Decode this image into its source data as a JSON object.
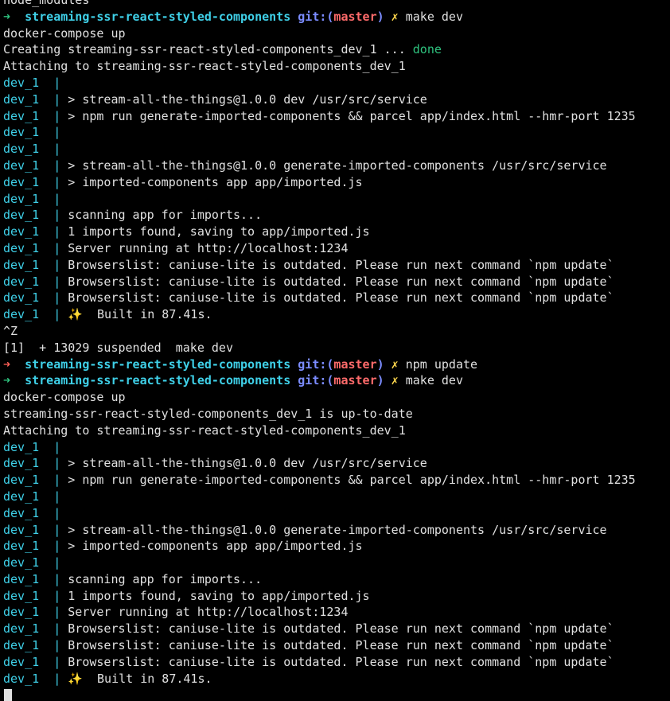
{
  "terminal": {
    "colors": {
      "background": "#000000",
      "foreground": "#e0e0e0",
      "prompt_ok": "#2ec27e",
      "prompt_err": "#ff5f56",
      "cwd": "#3fd0e8",
      "git": "#7b8cff",
      "branch": "#ff6b6b",
      "dirty": "#ffd84d",
      "done": "#2ec27e",
      "service_prefix": "#3fd0e8"
    },
    "lines": [
      [
        {
          "t": "node_modules",
          "k": "default"
        }
      ],
      [
        {
          "t": "➜  ",
          "k": "arrow-ok"
        },
        {
          "t": "streaming-ssr-react-styled-components",
          "k": "cwd"
        },
        {
          "t": " git:(",
          "k": "git"
        },
        {
          "t": "master",
          "k": "branch"
        },
        {
          "t": ")",
          "k": "git"
        },
        {
          "t": " ✗ ",
          "k": "dirty"
        },
        {
          "t": "make dev",
          "k": "default"
        }
      ],
      [
        {
          "t": "docker-compose up",
          "k": "default"
        }
      ],
      [
        {
          "t": "Creating streaming-ssr-react-styled-components_dev_1 ... ",
          "k": "default"
        },
        {
          "t": "done",
          "k": "done"
        }
      ],
      [
        {
          "t": "Attaching to streaming-ssr-react-styled-components_dev_1",
          "k": "default"
        }
      ],
      [
        {
          "t": "dev_1  | ",
          "k": "svc"
        }
      ],
      [
        {
          "t": "dev_1  | ",
          "k": "svc"
        },
        {
          "t": "> stream-all-the-things@1.0.0 dev /usr/src/service",
          "k": "default"
        }
      ],
      [
        {
          "t": "dev_1  | ",
          "k": "svc"
        },
        {
          "t": "> npm run generate-imported-components && parcel app/index.html --hmr-port 1235",
          "k": "default"
        }
      ],
      [
        {
          "t": "dev_1  | ",
          "k": "svc"
        }
      ],
      [
        {
          "t": "dev_1  | ",
          "k": "svc"
        }
      ],
      [
        {
          "t": "dev_1  | ",
          "k": "svc"
        },
        {
          "t": "> stream-all-the-things@1.0.0 generate-imported-components /usr/src/service",
          "k": "default"
        }
      ],
      [
        {
          "t": "dev_1  | ",
          "k": "svc"
        },
        {
          "t": "> imported-components app app/imported.js",
          "k": "default"
        }
      ],
      [
        {
          "t": "dev_1  | ",
          "k": "svc"
        }
      ],
      [
        {
          "t": "dev_1  | ",
          "k": "svc"
        },
        {
          "t": "scanning app for imports...",
          "k": "default"
        }
      ],
      [
        {
          "t": "dev_1  | ",
          "k": "svc"
        },
        {
          "t": "1 imports found, saving to app/imported.js",
          "k": "default"
        }
      ],
      [
        {
          "t": "dev_1  | ",
          "k": "svc"
        },
        {
          "t": "Server running at http://localhost:1234",
          "k": "default"
        }
      ],
      [
        {
          "t": "dev_1  | ",
          "k": "svc"
        },
        {
          "t": "Browserslist: caniuse-lite is outdated. Please run next command `npm update`",
          "k": "default"
        }
      ],
      [
        {
          "t": "dev_1  | ",
          "k": "svc"
        },
        {
          "t": "Browserslist: caniuse-lite is outdated. Please run next command `npm update`",
          "k": "default"
        }
      ],
      [
        {
          "t": "dev_1  | ",
          "k": "svc"
        },
        {
          "t": "Browserslist: caniuse-lite is outdated. Please run next command `npm update`",
          "k": "default"
        }
      ],
      [
        {
          "t": "dev_1  | ",
          "k": "svc"
        },
        {
          "t": "✨",
          "k": "sparkle"
        },
        {
          "t": "  Built in 87.41s.",
          "k": "default"
        }
      ],
      [
        {
          "t": "^Z",
          "k": "default"
        }
      ],
      [
        {
          "t": "[1]  + 13029 suspended  make dev",
          "k": "default"
        }
      ],
      [
        {
          "t": "➜  ",
          "k": "arrow-err"
        },
        {
          "t": "streaming-ssr-react-styled-components",
          "k": "cwd"
        },
        {
          "t": " git:(",
          "k": "git"
        },
        {
          "t": "master",
          "k": "branch"
        },
        {
          "t": ")",
          "k": "git"
        },
        {
          "t": " ✗ ",
          "k": "dirty"
        },
        {
          "t": "npm update",
          "k": "default"
        }
      ],
      [
        {
          "t": "➜  ",
          "k": "arrow-ok"
        },
        {
          "t": "streaming-ssr-react-styled-components",
          "k": "cwd"
        },
        {
          "t": " git:(",
          "k": "git"
        },
        {
          "t": "master",
          "k": "branch"
        },
        {
          "t": ")",
          "k": "git"
        },
        {
          "t": " ✗ ",
          "k": "dirty"
        },
        {
          "t": "make dev",
          "k": "default"
        }
      ],
      [
        {
          "t": "docker-compose up",
          "k": "default"
        }
      ],
      [
        {
          "t": "streaming-ssr-react-styled-components_dev_1 is up-to-date",
          "k": "default"
        }
      ],
      [
        {
          "t": "Attaching to streaming-ssr-react-styled-components_dev_1",
          "k": "default"
        }
      ],
      [
        {
          "t": "dev_1  | ",
          "k": "svc"
        }
      ],
      [
        {
          "t": "dev_1  | ",
          "k": "svc"
        },
        {
          "t": "> stream-all-the-things@1.0.0 dev /usr/src/service",
          "k": "default"
        }
      ],
      [
        {
          "t": "dev_1  | ",
          "k": "svc"
        },
        {
          "t": "> npm run generate-imported-components && parcel app/index.html --hmr-port 1235",
          "k": "default"
        }
      ],
      [
        {
          "t": "dev_1  | ",
          "k": "svc"
        }
      ],
      [
        {
          "t": "dev_1  | ",
          "k": "svc"
        }
      ],
      [
        {
          "t": "dev_1  | ",
          "k": "svc"
        },
        {
          "t": "> stream-all-the-things@1.0.0 generate-imported-components /usr/src/service",
          "k": "default"
        }
      ],
      [
        {
          "t": "dev_1  | ",
          "k": "svc"
        },
        {
          "t": "> imported-components app app/imported.js",
          "k": "default"
        }
      ],
      [
        {
          "t": "dev_1  | ",
          "k": "svc"
        }
      ],
      [
        {
          "t": "dev_1  | ",
          "k": "svc"
        },
        {
          "t": "scanning app for imports...",
          "k": "default"
        }
      ],
      [
        {
          "t": "dev_1  | ",
          "k": "svc"
        },
        {
          "t": "1 imports found, saving to app/imported.js",
          "k": "default"
        }
      ],
      [
        {
          "t": "dev_1  | ",
          "k": "svc"
        },
        {
          "t": "Server running at http://localhost:1234",
          "k": "default"
        }
      ],
      [
        {
          "t": "dev_1  | ",
          "k": "svc"
        },
        {
          "t": "Browserslist: caniuse-lite is outdated. Please run next command `npm update`",
          "k": "default"
        }
      ],
      [
        {
          "t": "dev_1  | ",
          "k": "svc"
        },
        {
          "t": "Browserslist: caniuse-lite is outdated. Please run next command `npm update`",
          "k": "default"
        }
      ],
      [
        {
          "t": "dev_1  | ",
          "k": "svc"
        },
        {
          "t": "Browserslist: caniuse-lite is outdated. Please run next command `npm update`",
          "k": "default"
        }
      ],
      [
        {
          "t": "dev_1  | ",
          "k": "svc"
        },
        {
          "t": "✨",
          "k": "sparkle"
        },
        {
          "t": "  Built in 87.41s.",
          "k": "default"
        }
      ]
    ]
  }
}
